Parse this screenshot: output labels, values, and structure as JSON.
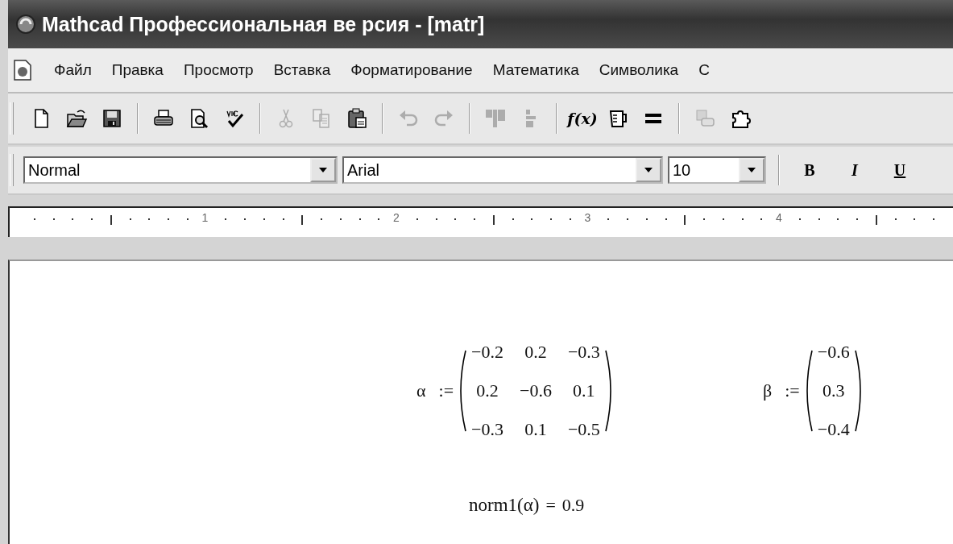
{
  "window": {
    "title": "Mathcad Профессиональная ве рсия - [matr]"
  },
  "menu": [
    "Файл",
    "Правка",
    "Просмотр",
    "Вставка",
    "Форматирование",
    "Математика",
    "Символика",
    "С"
  ],
  "toolbar": [
    [
      {
        "kind": "new",
        "disabled": false
      },
      {
        "kind": "open",
        "disabled": false
      },
      {
        "kind": "save",
        "disabled": false
      }
    ],
    [
      {
        "kind": "print",
        "disabled": false
      },
      {
        "kind": "preview",
        "disabled": false
      },
      {
        "kind": "spell",
        "disabled": false
      }
    ],
    [
      {
        "kind": "cut",
        "disabled": true
      },
      {
        "kind": "copy",
        "disabled": true
      },
      {
        "kind": "paste",
        "disabled": false
      }
    ],
    [
      {
        "kind": "undo",
        "disabled": true
      },
      {
        "kind": "redo",
        "disabled": true
      }
    ],
    [
      {
        "kind": "align_top",
        "disabled": true
      },
      {
        "kind": "align_down",
        "disabled": true
      }
    ],
    [
      {
        "kind": "function",
        "label": "f(x)",
        "disabled": false
      },
      {
        "kind": "units",
        "disabled": false
      },
      {
        "kind": "equals",
        "disabled": false
      }
    ],
    [
      {
        "kind": "resource",
        "disabled": true
      },
      {
        "kind": "component",
        "disabled": false
      }
    ]
  ],
  "format_bar": {
    "style": "Normal",
    "font": "Arial",
    "size": "10",
    "buttons": [
      {
        "kind": "bold",
        "label": "B"
      },
      {
        "kind": "italic",
        "label": "I"
      },
      {
        "kind": "underline",
        "label": "U"
      }
    ]
  },
  "ruler": {
    "labels": [
      "1",
      "2",
      "3",
      "4"
    ]
  },
  "worksheet": [
    {
      "kind": "matrix",
      "name": "α",
      "op": ":=",
      "rows": [
        [
          "−0.2",
          "0.2",
          "−0.3"
        ],
        [
          "0.2",
          "−0.6",
          "0.1"
        ],
        [
          "−0.3",
          "0.1",
          "−0.5"
        ]
      ]
    },
    {
      "kind": "matrix",
      "name": "β",
      "op": ":=",
      "rows": [
        [
          "−0.6"
        ],
        [
          "0.3"
        ],
        [
          "−0.4"
        ]
      ]
    },
    {
      "kind": "evaluation",
      "expression": "norm1(α)",
      "op": "=",
      "result": "0.9"
    }
  ]
}
